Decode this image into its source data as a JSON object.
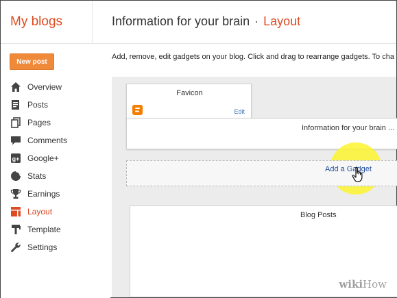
{
  "header": {
    "brand": "My blogs",
    "blog_title": "Information for your brain",
    "separator": "·",
    "section": "Layout"
  },
  "sidebar": {
    "new_post_label": "New post",
    "items": [
      {
        "label": "Overview",
        "icon": "home-icon"
      },
      {
        "label": "Posts",
        "icon": "posts-icon"
      },
      {
        "label": "Pages",
        "icon": "pages-icon"
      },
      {
        "label": "Comments",
        "icon": "comments-icon"
      },
      {
        "label": "Google+",
        "icon": "google-plus-icon"
      },
      {
        "label": "Stats",
        "icon": "stats-icon"
      },
      {
        "label": "Earnings",
        "icon": "trophy-icon"
      },
      {
        "label": "Layout",
        "icon": "layout-icon",
        "active": true
      },
      {
        "label": "Template",
        "icon": "template-icon"
      },
      {
        "label": "Settings",
        "icon": "wrench-icon"
      }
    ]
  },
  "main": {
    "description": "Add, remove, edit gadgets on your blog. Click and drag to rearrange gadgets. To cha",
    "favicon_title": "Favicon",
    "favicon_edit": "Edit",
    "header_gadget": "Information for your brain ...",
    "add_gadget": "Add a Gadget",
    "blog_posts": "Blog Posts"
  },
  "watermark": {
    "bold": "wiki",
    "rest": "How"
  },
  "colors": {
    "accent": "#dd4b23",
    "button": "#f08a3b",
    "link": "#1f4e9c",
    "highlight": "#fcf52f"
  }
}
